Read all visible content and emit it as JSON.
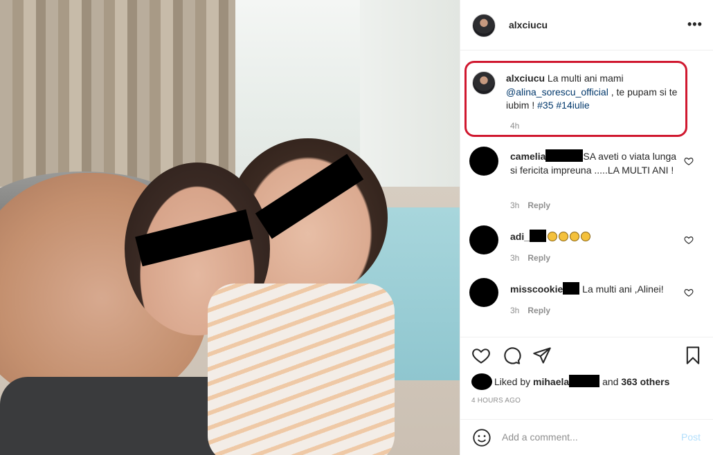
{
  "post": {
    "username": "alxciucu",
    "more_icon": "more-horizontal-icon",
    "caption": {
      "username": "alxciucu",
      "text_before": "La multi ani mami ",
      "mention": "@alina_sorescu_official",
      "text_after": " , te pupam si te iubim ! ",
      "tag1": "#35",
      "tag2": "#14iulie",
      "time": "4h"
    },
    "comments": [
      {
        "username": "camelia",
        "text": "SA aveti o viata lunga si fericita impreuna .....LA MULTI ANI !",
        "time": "3h",
        "reply": "Reply"
      },
      {
        "username": "adi_",
        "text": "",
        "time": "3h",
        "reply": "Reply"
      },
      {
        "username": "misscookie",
        "text": " La multi ani ,Alinei!",
        "time": "3h",
        "reply": "Reply"
      }
    ],
    "likes": {
      "prefix": "Liked by ",
      "user": "mihaela",
      "suffix_and": " and ",
      "others": "363 others"
    },
    "time_ago": "4 HOURS AGO",
    "add_comment": {
      "placeholder": "Add a comment...",
      "post_label": "Post"
    }
  },
  "colors": {
    "highlight": "#d0182f",
    "link": "#00376b",
    "muted": "#8e8e8e",
    "post_disabled": "#b2dffc"
  }
}
